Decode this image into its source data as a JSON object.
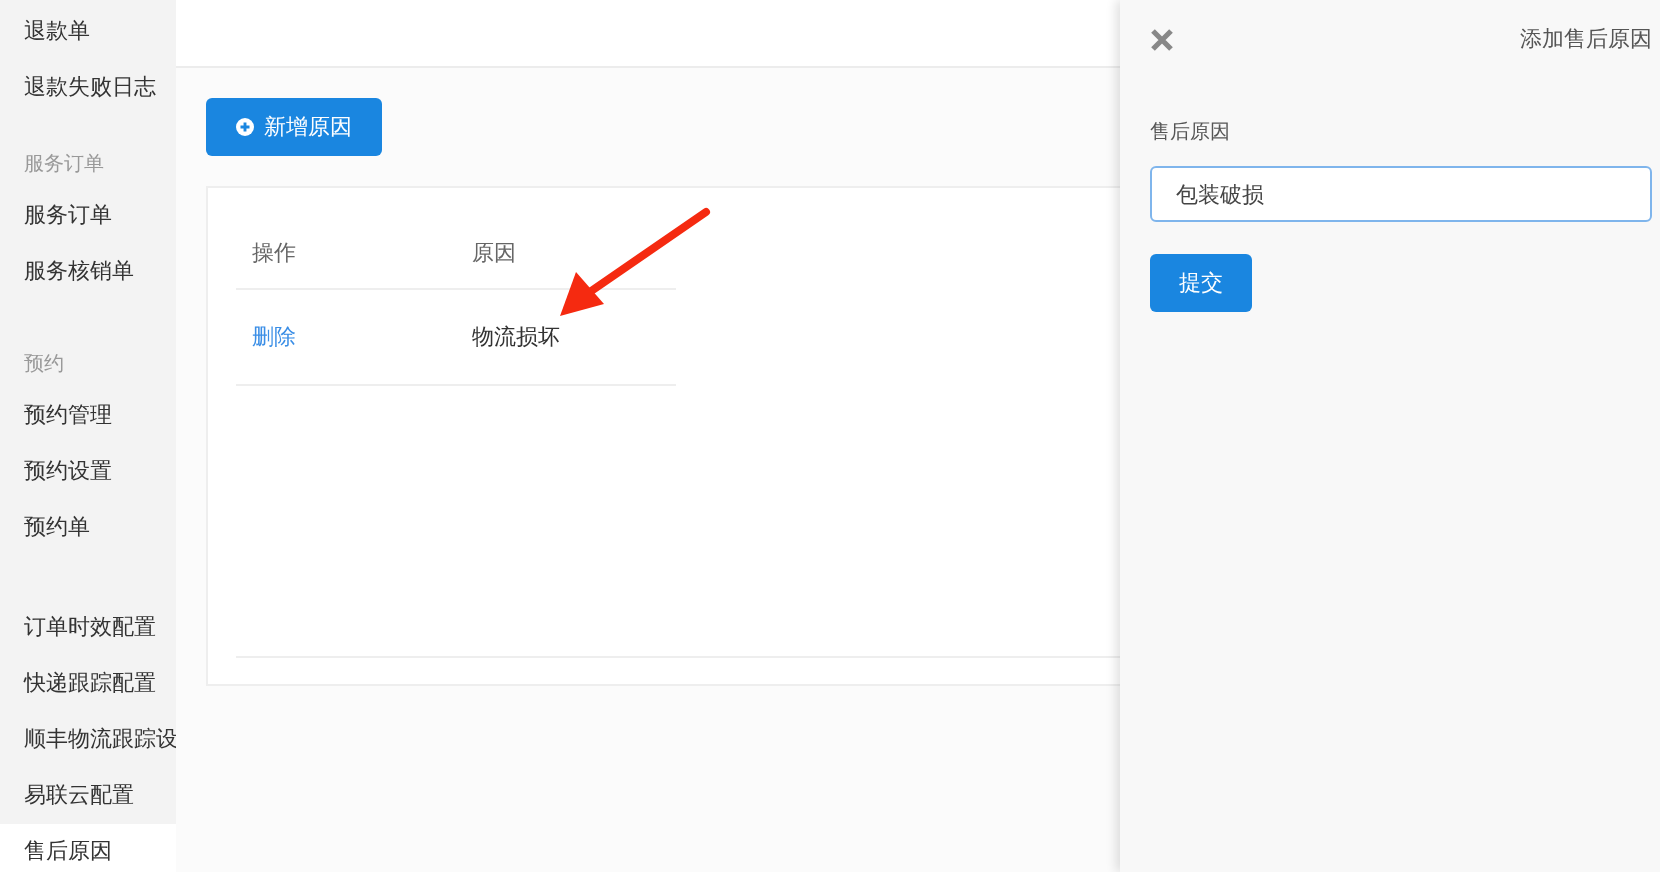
{
  "sidebar": {
    "groups": [
      {
        "items": [
          {
            "label": "退款单",
            "selected": false
          },
          {
            "label": "退款失败日志",
            "selected": false
          }
        ]
      },
      {
        "heading": "服务订单",
        "items": [
          {
            "label": "服务订单",
            "selected": false
          },
          {
            "label": "服务核销单",
            "selected": false
          }
        ]
      },
      {
        "heading": "预约",
        "items": [
          {
            "label": "预约管理",
            "selected": false
          },
          {
            "label": "预约设置",
            "selected": false
          },
          {
            "label": "预约单",
            "selected": false
          }
        ]
      },
      {
        "items": [
          {
            "label": "订单时效配置",
            "selected": false
          },
          {
            "label": "快递跟踪配置",
            "selected": false
          },
          {
            "label": "顺丰物流跟踪设",
            "selected": false
          },
          {
            "label": "易联云配置",
            "selected": false
          },
          {
            "label": "售后原因",
            "selected": true
          }
        ]
      }
    ]
  },
  "add_button": "新增原因",
  "table": {
    "columns": [
      "操作",
      "原因"
    ],
    "rows": [
      {
        "action": "删除",
        "reason": "物流损坏"
      }
    ]
  },
  "panel": {
    "title": "添加售后原因",
    "field_label": "售后原因",
    "field_value": "包装破损",
    "submit": "提交"
  }
}
